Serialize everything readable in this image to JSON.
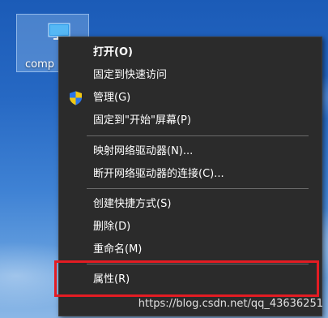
{
  "desktop": {
    "icon_label": "comp",
    "icon_name": "computer-icon"
  },
  "context_menu": {
    "items": [
      {
        "label": "打开(O)",
        "bold": true
      },
      {
        "label": "固定到快速访问"
      },
      {
        "label": "管理(G)",
        "icon": "uac-shield-icon"
      },
      {
        "label": "固定到\"开始\"屏幕(P)"
      },
      {
        "label": "映射网络驱动器(N)..."
      },
      {
        "label": "断开网络驱动器的连接(C)..."
      },
      {
        "label": "创建快捷方式(S)"
      },
      {
        "label": "删除(D)"
      },
      {
        "label": "重命名(M)"
      },
      {
        "label": "属性(R)"
      }
    ]
  },
  "highlight": {
    "target": "属性(R)",
    "color": "#e31c23"
  },
  "watermark": "https://blog.csdn.net/qq_43636251",
  "colors": {
    "menu_bg": "#2b2b2b",
    "menu_text": "#ffffff",
    "separator": "#6b6b6b"
  }
}
